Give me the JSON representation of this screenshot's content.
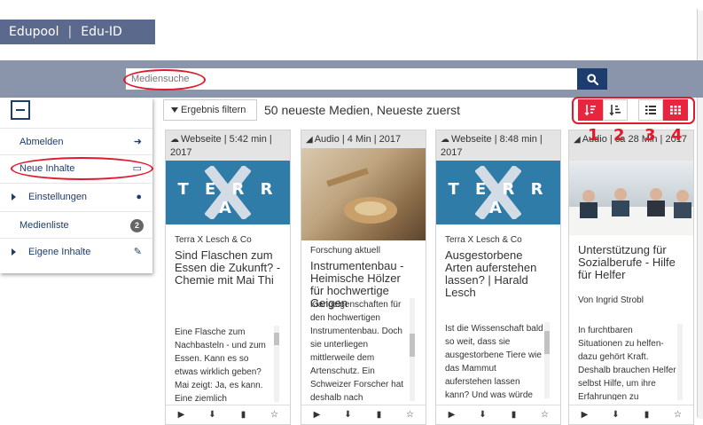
{
  "header": {
    "brand": "Edupool",
    "product": "Edu-ID"
  },
  "search": {
    "placeholder": "Mediensuche"
  },
  "sidebar": {
    "items": [
      {
        "label": "Abmelden",
        "icon": "sign-out-icon"
      },
      {
        "label": "Neue Inhalte",
        "icon": "calendar-icon"
      },
      {
        "label": "Einstellungen",
        "icon": "user-icon"
      },
      {
        "label": "Medienliste",
        "badge": "2"
      },
      {
        "label": "Eigene Inhalte",
        "icon": "edit-icon"
      }
    ]
  },
  "toolbar": {
    "filter_label": "Ergebnis filtern",
    "result_text": "50 neueste Medien, Neueste zuerst"
  },
  "annotations": [
    "1",
    "2",
    "3",
    "4"
  ],
  "cards": [
    {
      "meta": "Webseite | 5:42 min | 2017",
      "series": "Terra X Lesch & Co",
      "title": "Sind Flaschen zum Essen die Zukunft? - Chemie mit Mai Thi",
      "desc": "Eine Flasche zum Nachbasteln - und zum Essen. Kann es so etwas wirklich geben? Mai zeigt: Ja, es kann. Eine ziemlich"
    },
    {
      "meta": "Audio | 4 Min | 2017",
      "series": "Forschung aktuell",
      "title": "Instrumentenbau - Heimische Hölzer für hochwertige Geigen",
      "desc": "Klangeigenschaften für den hochwertigen Instrumentenbau. Doch sie unterliegen mittlerweile dem Artenschutz. Ein Schweizer Forscher hat deshalb nach"
    },
    {
      "meta": "Webseite | 8:48 min | 2017",
      "series": "Terra X Lesch & Co",
      "title": "Ausgestorbene Arten auferstehen lassen? | Harald Lesch",
      "desc": "Ist die Wissenschaft bald so weit, dass sie ausgestorbene Tiere wie das Mammut auferstehen lassen kann? Und was würde"
    },
    {
      "meta": "Audio | ca 28 Min | 2017",
      "series": "",
      "title": "Unterstützung für Sozialberufe - Hilfe für Helfer",
      "author": "Von Ingrid Strobl",
      "desc": "In furchtbaren Situationen zu helfen- dazu gehört Kraft. Deshalb brauchen Helfer selbst Hilfe, um ihre Erfahrungen zu"
    }
  ]
}
